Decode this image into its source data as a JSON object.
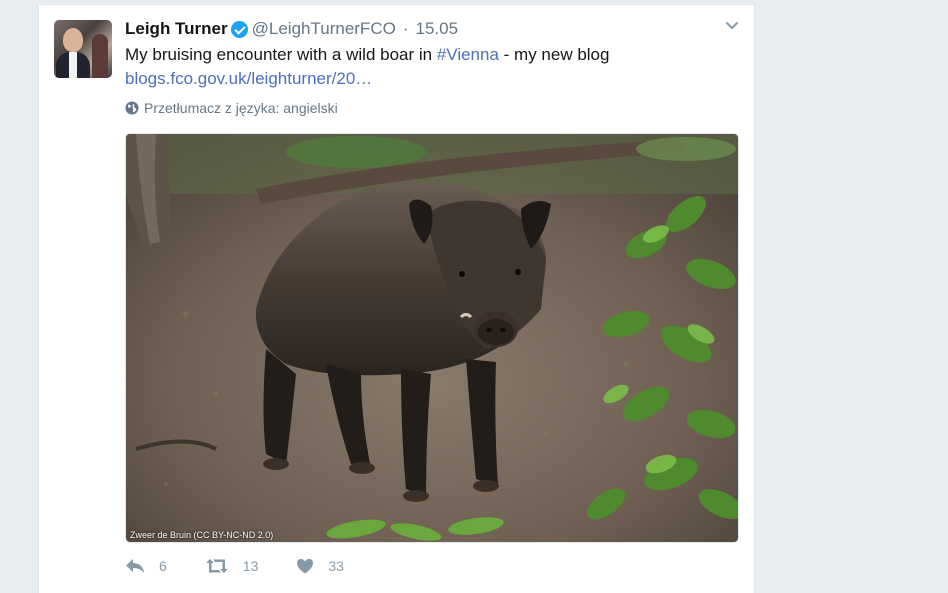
{
  "tweet": {
    "author_name": "Leigh Turner",
    "handle": "@LeighTurnerFCO",
    "separator": "·",
    "time": "15.05",
    "text_main": "My bruising encounter with a wild boar in ",
    "hashtag": "#Vienna",
    "text_tail": " - my new blog",
    "link": "blogs.fco.gov.uk/leighturner/20…",
    "translate_label": "Przetłumacz z języka: angielski",
    "photo_credit": "Zweer de Bruin (CC BY-NC-ND 2.0)",
    "photo_subject": "wild boar in forest",
    "replies": "6",
    "retweets": "13",
    "likes": "33"
  },
  "icons": {
    "verified": "verified-badge-icon",
    "caret": "chevron-down-icon",
    "globe": "globe-icon",
    "reply": "reply-icon",
    "retweet": "retweet-icon",
    "like": "heart-icon"
  },
  "colors": {
    "background": "#e6ecf0",
    "card": "#ffffff",
    "link": "#4e6fbf",
    "muted": "#657786",
    "action": "#8899a6",
    "verified": "#1da1f2"
  }
}
